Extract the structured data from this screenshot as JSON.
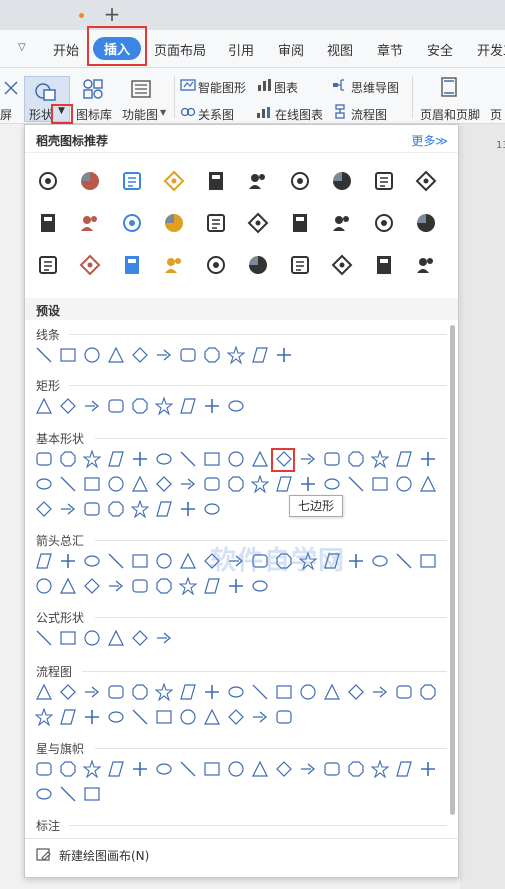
{
  "tabstrip": {
    "newtab_label": "+"
  },
  "menubar": {
    "items": [
      {
        "label": "开始"
      },
      {
        "label": "插入",
        "active": true
      },
      {
        "label": "页面布局"
      },
      {
        "label": "引用"
      },
      {
        "label": "审阅"
      },
      {
        "label": "视图"
      },
      {
        "label": "章节"
      },
      {
        "label": "安全"
      },
      {
        "label": "开发工"
      }
    ]
  },
  "ribbon": {
    "left_cut": "屏",
    "shape_label": "形状",
    "icon_lib_label": "图标库",
    "func_label": "功能图",
    "smart_shape": "智能图形",
    "chart": "图表",
    "mindmap": "思维导图",
    "relation": "关系图",
    "online_chart": "在线图表",
    "flowchart": "流程图",
    "header_footer": "页眉和页脚",
    "right_cut": "页"
  },
  "panel": {
    "title": "稻壳图标推荐",
    "more_label": "更多≫",
    "preset_title": "预设",
    "categories": [
      {
        "name": "线条"
      },
      {
        "name": "矩形"
      },
      {
        "name": "基本形状"
      },
      {
        "name": "箭头总汇"
      },
      {
        "name": "公式形状"
      },
      {
        "name": "流程图"
      },
      {
        "name": "星与旗帜"
      },
      {
        "name": "标注"
      }
    ],
    "tooltip": "七边形",
    "new_canvas": "新建绘图画布(N)"
  },
  "colors": {
    "accent": "#3d85e2",
    "highlight_box": "#e53935",
    "shape_stroke": "#3f6cb4",
    "link": "#2f7ce0"
  },
  "document": {
    "ruler_marker": "13"
  },
  "watermark": "软件自学网"
}
